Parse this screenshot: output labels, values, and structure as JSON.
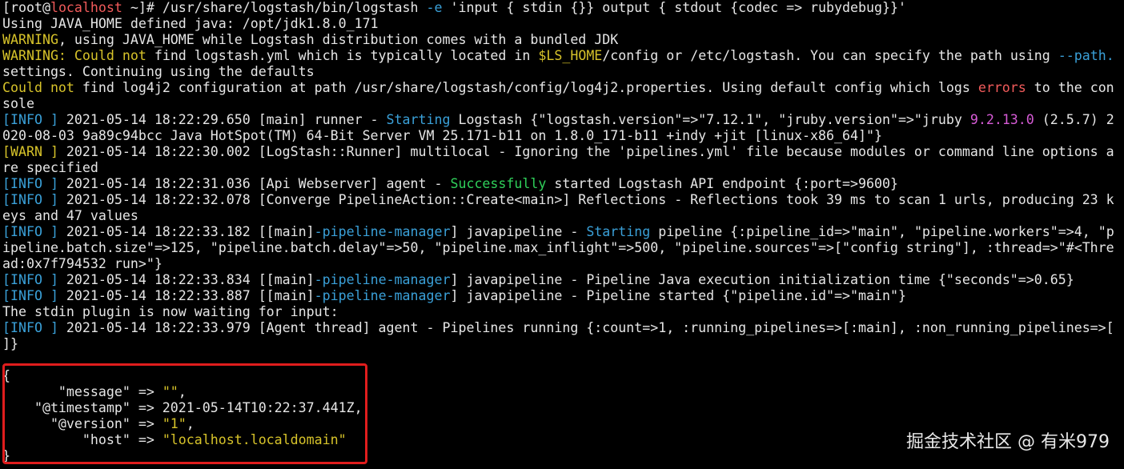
{
  "colors": {
    "background": "#000000",
    "default_text": "#e6e6e6",
    "yellow": "#d7c32a",
    "red": "#f25b5b",
    "blue": "#3aa0d8",
    "green": "#2fd05a",
    "magenta": "#d65bd6",
    "highlight_border": "#e01d1d"
  },
  "terminal_lines": [
    [
      {
        "t": "[root@"
      },
      {
        "t": "localhost",
        "c": "red"
      },
      {
        "t": " ~]# /usr/share/logstash/bin/logstash "
      },
      {
        "t": "-e",
        "c": "blue"
      },
      {
        "t": " 'input { stdin {}} output { stdout {codec => rubydebug}}'"
      }
    ],
    [
      {
        "t": "Using JAVA_HOME defined java: /opt/jdk1.8.0_171"
      }
    ],
    [
      {
        "t": "WARNING",
        "c": "yellow"
      },
      {
        "t": ", using JAVA_HOME while Logstash distribution comes with a bundled JDK"
      }
    ],
    [
      {
        "t": "WARNING: ",
        "c": "yellow"
      },
      {
        "t": "Could not",
        "c": "yellow"
      },
      {
        "t": " find logstash.yml which is typically located in "
      },
      {
        "t": "$LS_HOME",
        "c": "yellow"
      },
      {
        "t": "/config or /etc/logstash. You can specify the path using "
      },
      {
        "t": "--path.",
        "c": "blue"
      }
    ],
    [
      {
        "t": "settings. Continuing using the defaults"
      }
    ],
    [
      {
        "t": "Could not",
        "c": "yellow"
      },
      {
        "t": " find log4j2 configuration at path /usr/share/logstash/config/log4j2.properties. Using default config which logs "
      },
      {
        "t": "errors",
        "c": "red"
      },
      {
        "t": " to the con"
      }
    ],
    [
      {
        "t": "sole"
      }
    ],
    [
      {
        "t": "[INFO ]",
        "c": "blue"
      },
      {
        "t": " 2021-05-14 18:22:29.650 [main] runner - "
      },
      {
        "t": "Starting",
        "c": "blue"
      },
      {
        "t": " Logstash {\"logstash.version\"=>\"7.12.1\", \"jruby.version\"=>\"jruby "
      },
      {
        "t": "9.2.13.0",
        "c": "magenta"
      },
      {
        "t": " (2.5.7) 2"
      }
    ],
    [
      {
        "t": "020-08-03 9a89c94bcc Java HotSpot(TM) 64-Bit Server VM 25.171-b11 on 1.8.0_171-b11 +indy +jit [linux-x86_64]\"}"
      }
    ],
    [
      {
        "t": "[WARN ]",
        "c": "yellow"
      },
      {
        "t": " 2021-05-14 18:22:30.002 [LogStash::Runner] multilocal - Ignoring the 'pipelines.yml' file because modules or command line options a"
      }
    ],
    [
      {
        "t": "re specified"
      }
    ],
    [
      {
        "t": "[INFO ]",
        "c": "blue"
      },
      {
        "t": " 2021-05-14 18:22:31.036 [Api Webserver] agent - "
      },
      {
        "t": "Successfully",
        "c": "green"
      },
      {
        "t": " started Logstash API endpoint {:port=>9600}"
      }
    ],
    [
      {
        "t": "[INFO ]",
        "c": "blue"
      },
      {
        "t": " 2021-05-14 18:22:32.078 [Converge PipelineAction::Create<main>] Reflections - Reflections took 39 ms to scan 1 urls, producing 23 k"
      }
    ],
    [
      {
        "t": "eys and 47 values"
      }
    ],
    [
      {
        "t": "[INFO ]",
        "c": "blue"
      },
      {
        "t": " 2021-05-14 18:22:33.182 [[main]"
      },
      {
        "t": "-pipeline-manager",
        "c": "blue"
      },
      {
        "t": "] javapipeline - "
      },
      {
        "t": "Starting",
        "c": "blue"
      },
      {
        "t": " pipeline {:pipeline_id=>\"main\", \"pipeline.workers\"=>4, \"p"
      }
    ],
    [
      {
        "t": "ipeline.batch.size\"=>125, \"pipeline.batch.delay\"=>50, \"pipeline.max_inflight\"=>500, \"pipeline.sources\"=>[\"config string\"], :thread=>\"#<Thre"
      }
    ],
    [
      {
        "t": "ad:0x7f794532 run>\"}"
      }
    ],
    [
      {
        "t": "[INFO ]",
        "c": "blue"
      },
      {
        "t": " 2021-05-14 18:22:33.834 [[main]"
      },
      {
        "t": "-pipeline-manager",
        "c": "blue"
      },
      {
        "t": "] javapipeline - Pipeline Java execution initialization time {\"seconds\"=>0.65}"
      }
    ],
    [
      {
        "t": "[INFO ]",
        "c": "blue"
      },
      {
        "t": " 2021-05-14 18:22:33.887 [[main]"
      },
      {
        "t": "-pipeline-manager",
        "c": "blue"
      },
      {
        "t": "] javapipeline - Pipeline started {\"pipeline.id\"=>\"main\"}"
      }
    ],
    [
      {
        "t": "The stdin plugin is now waiting for input:"
      }
    ],
    [
      {
        "t": "[INFO ]",
        "c": "blue"
      },
      {
        "t": " 2021-05-14 18:22:33.979 [Agent thread] agent - Pipelines running {:count=>1, :running_pipelines=>[:main], :non_running_pipelines=>["
      }
    ],
    [
      {
        "t": "]}"
      }
    ],
    [
      {
        "t": ""
      }
    ],
    [
      {
        "t": "{"
      }
    ],
    [
      {
        "t": "       \"message\" => "
      },
      {
        "t": "\"\"",
        "c": "yellow"
      },
      {
        "t": ","
      }
    ],
    [
      {
        "t": "    \"@timestamp\" => 2021-05-14T10:22:37.441Z,"
      }
    ],
    [
      {
        "t": "      \"@version\" => "
      },
      {
        "t": "\"1\"",
        "c": "yellow"
      },
      {
        "t": ","
      }
    ],
    [
      {
        "t": "          \"host\" => "
      },
      {
        "t": "\"localhost.localdomain\"",
        "c": "yellow"
      }
    ],
    [
      {
        "t": "}"
      }
    ]
  ],
  "watermark": "掘金技术社区 @ 有米979"
}
